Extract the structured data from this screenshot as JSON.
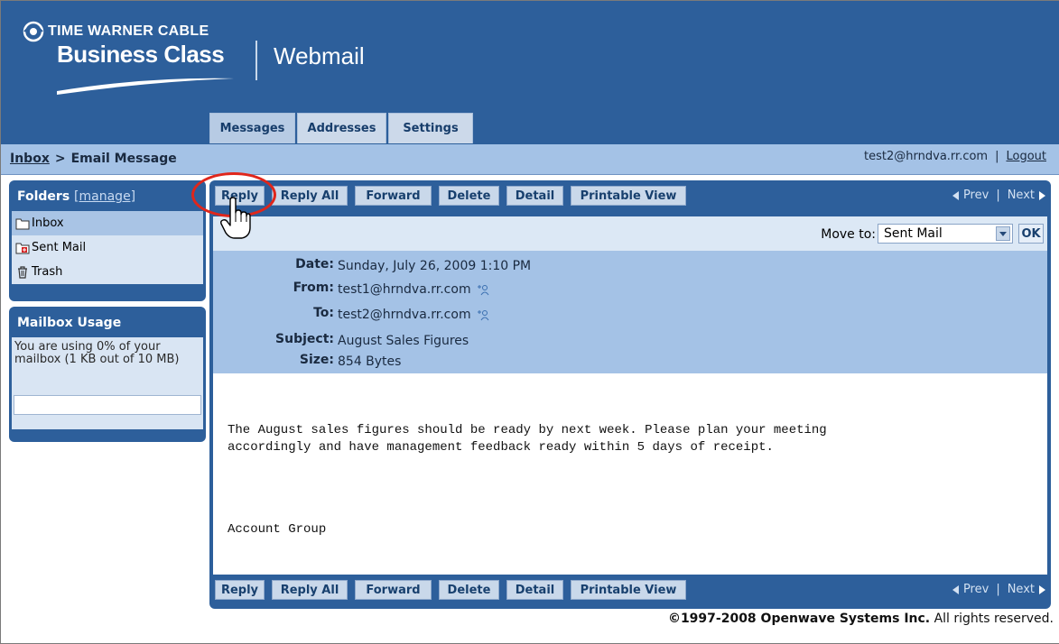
{
  "brand": {
    "company": "TIME WARNER CABLE",
    "product": "Business Class",
    "app_title": "Webmail"
  },
  "tabs": [
    {
      "label": "Messages",
      "active": true
    },
    {
      "label": "Addresses",
      "active": false
    },
    {
      "label": "Settings",
      "active": false
    }
  ],
  "breadcrumb": {
    "inbox": "Inbox",
    "separator": ">",
    "current": "Email Message"
  },
  "user": {
    "email": "test2@hrndva.rr.com",
    "separator": "|",
    "logout": "Logout"
  },
  "folders": {
    "title": "Folders",
    "manage": "[manage]",
    "items": [
      {
        "label": "Inbox",
        "icon": "folder-icon",
        "active": true
      },
      {
        "label": "Sent Mail",
        "icon": "sent-folder-icon",
        "active": false
      },
      {
        "label": "Trash",
        "icon": "trash-icon",
        "active": false
      }
    ]
  },
  "mailbox_usage": {
    "title": "Mailbox Usage",
    "text": "You are using 0% of your mailbox (1 KB out of 10 MB)",
    "percent_used": 0
  },
  "actions": {
    "reply": "Reply",
    "reply_all": "Reply All",
    "forward": "Forward",
    "delete": "Delete",
    "detail": "Detail",
    "printable_view": "Printable View",
    "prev": "Prev",
    "pager_separator": "|",
    "next": "Next"
  },
  "move": {
    "label": "Move to:",
    "selected": "Sent Mail",
    "ok": "OK"
  },
  "message": {
    "date_label": "Date:",
    "date": "Sunday, July 26, 2009 1:10 PM",
    "from_label": "From:",
    "from": "test1@hrndva.rr.com",
    "to_label": "To:",
    "to": "test2@hrndva.rr.com",
    "subject_label": "Subject:",
    "subject": "August Sales Figures",
    "size_label": "Size:",
    "size": "854 Bytes",
    "body": "The August sales figures should be ready by next week. Please plan your meeting\naccordingly and have management feedback ready within 5 days of receipt.",
    "signature": "Account Group"
  },
  "footer": {
    "copyright_bold": "©1997-2008 Openwave Systems Inc.",
    "copyright_rest": " All rights reserved."
  },
  "colors": {
    "header_blue": "#2d5f9b",
    "light_blue": "#a4c2e6",
    "highlight_red": "#e0261b"
  }
}
